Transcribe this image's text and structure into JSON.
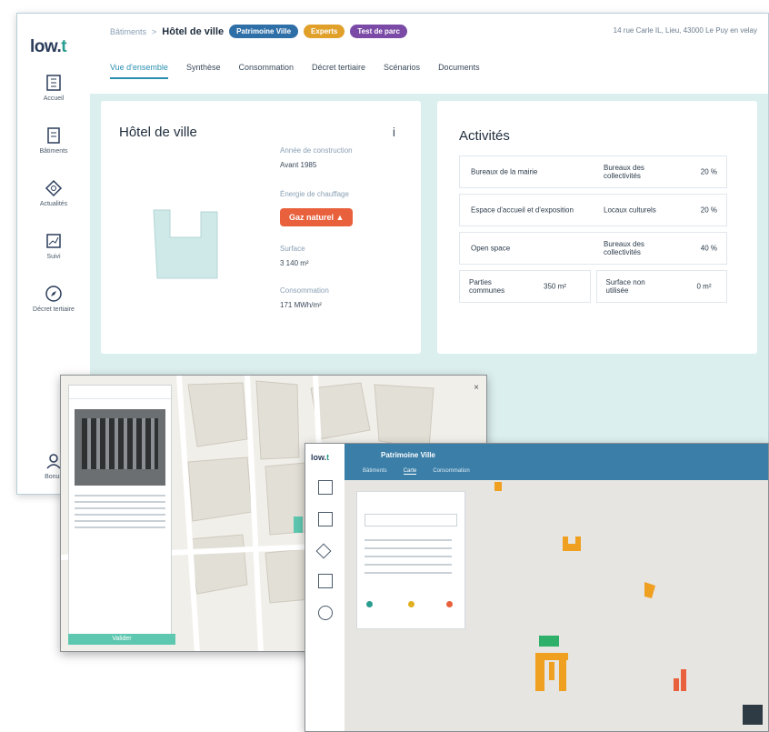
{
  "app": {
    "logo_text": "low.",
    "logo_dot": "t"
  },
  "sidebar": {
    "items": [
      {
        "label": "Accueil",
        "icon": "building-icon"
      },
      {
        "label": "Bâtiments",
        "icon": "document-icon"
      },
      {
        "label": "Actualités",
        "icon": "diamond-icon"
      },
      {
        "label": "Suivi",
        "icon": "chart-icon"
      },
      {
        "label": "Décret tertiaire",
        "icon": "compass-icon"
      }
    ],
    "bottom": {
      "label": "Bonus",
      "icon": "user-icon"
    }
  },
  "header": {
    "breadcrumb_root": "Bâtiments",
    "breadcrumb_sep": ">",
    "title": "Hôtel de ville",
    "badges": [
      {
        "label": "Patrimoine Ville",
        "color": "#2f6fa8"
      },
      {
        "label": "Experts",
        "color": "#e0a02a"
      },
      {
        "label": "Test de parc",
        "color": "#7a4aa6"
      }
    ],
    "address": "14 rue Carle IL, Lieu, 43000 Le Puy en velay"
  },
  "tabs": [
    {
      "label": "Vue d'ensemble",
      "active": true
    },
    {
      "label": "Synthèse"
    },
    {
      "label": "Consommation"
    },
    {
      "label": "Décret tertiaire"
    },
    {
      "label": "Scénarios"
    },
    {
      "label": "Documents"
    }
  ],
  "building_card": {
    "title": "Hôtel de ville",
    "info_icon": "i",
    "fields": [
      {
        "label": "Année de construction",
        "value": "Avant 1985"
      },
      {
        "label": "Énergie de chauffage",
        "value": "Gaz naturel"
      },
      {
        "label": "Surface",
        "value": "3 140 m²"
      },
      {
        "label": "Consommation",
        "value": "171 MWh/m²"
      }
    ]
  },
  "activities_card": {
    "title": "Activités",
    "rows": [
      {
        "name": "Bureaux de la mairie",
        "category": "Bureaux des collectivités",
        "pct": "20 %"
      },
      {
        "name": "Espace d'accueil et d'exposition",
        "category": "Locaux culturels",
        "pct": "20 %"
      },
      {
        "name": "Open space",
        "category": "Bureaux des collectivités",
        "pct": "40 %"
      }
    ],
    "footer": [
      {
        "label": "Parties communes",
        "value": "350 m²"
      },
      {
        "label": "Surface non utilisée",
        "value": "0 m²"
      }
    ]
  },
  "map_window": {
    "search_placeholder": "",
    "footer_button": "Valider"
  },
  "gis_window": {
    "title": "Patrimoine Ville",
    "tabs": [
      "Bâtiments",
      "Carte",
      "Consommation"
    ],
    "legend_colors": [
      "#2a9d8f",
      "#e0b020",
      "#e8603c"
    ]
  },
  "colors": {
    "accent": "#2a8fb0",
    "gas": "#e8603c",
    "content_bg": "#dcefef",
    "gis_header": "#3b7fa8",
    "building_orange": "#f0a020",
    "building_green": "#2eb06a"
  }
}
